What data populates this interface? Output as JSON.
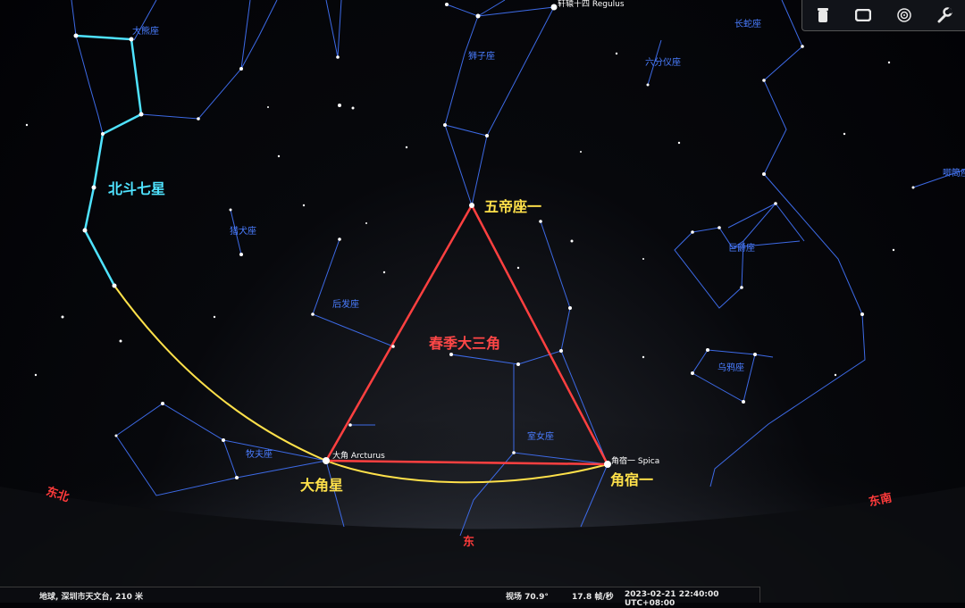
{
  "constellations": {
    "ursa_major": "大熊座",
    "leo": "狮子座",
    "hydra": "长蛇座",
    "sextans": "六分仪座",
    "canes_venatici": "猎犬座",
    "coma": "后发座",
    "crater": "巨爵座",
    "corvus": "乌鸦座",
    "bootes": "牧夫座",
    "virgo": "室女座",
    "edge_right": "唧筒座"
  },
  "stars": {
    "regulus": "轩辕十四 Regulus",
    "arcturus": "大角 Arcturus",
    "spica": "角宿一 Spica"
  },
  "annotations": {
    "big_dipper": "北斗七星",
    "denebola": "五帝座一",
    "spring_triangle": "春季大三角",
    "arcturus_big": "大角星",
    "spica_big": "角宿一"
  },
  "directions": {
    "northeast": "东北",
    "east": "东",
    "southeast": "东南"
  },
  "status": {
    "location": "地球, 深圳市天文台, 210 米",
    "fov": "视场 70.9°",
    "fps": "17.8 帧/秒",
    "datetime": "2023-02-21 22:40:00 UTC+08:00"
  },
  "toolbar": {
    "icons": [
      "trash-icon",
      "window-icon",
      "target-icon",
      "wrench-icon"
    ]
  },
  "colors": {
    "constellation_lines": "#3d6ae6",
    "big_dipper": "#4fe3ff",
    "triangle": "#ff4040",
    "arc": "#ffe14a",
    "direction": "#ff3b3b"
  }
}
